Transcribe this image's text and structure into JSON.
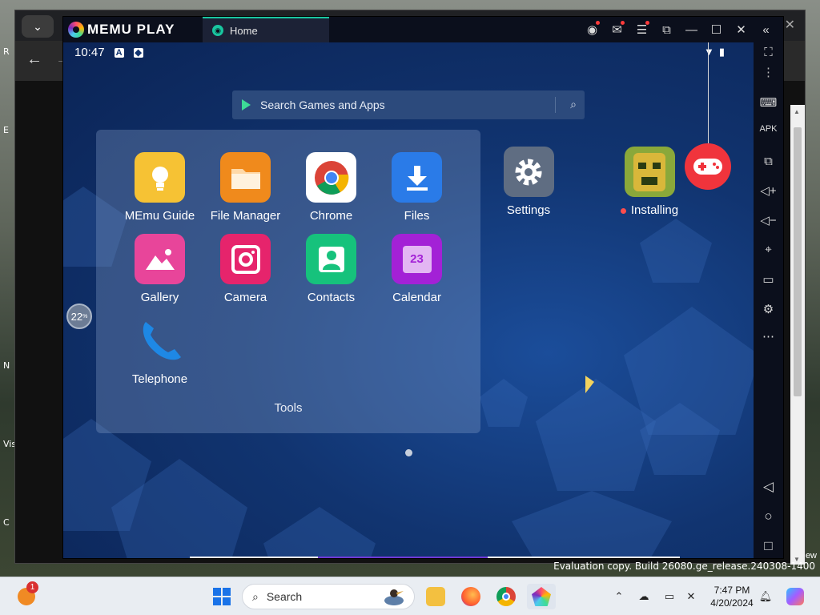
{
  "desktop": {
    "side_labels": [
      "R",
      "E",
      "N",
      "Vis",
      "C"
    ],
    "right_label": "ew"
  },
  "memu": {
    "logo_text": "MEMU PLAY",
    "tab_label": "Home",
    "statusbar": {
      "time": "10:47"
    },
    "search_placeholder": "Search Games and Apps",
    "folder": {
      "name": "Tools",
      "apps": [
        {
          "label": "MEmu Guide",
          "icon": "lightbulb-icon",
          "color": "#f6c234"
        },
        {
          "label": "File Manager",
          "icon": "folder-icon",
          "color": "#f08a1c"
        },
        {
          "label": "Chrome",
          "icon": "chrome-icon",
          "color": "#ffffff"
        },
        {
          "label": "Files",
          "icon": "download-icon",
          "color": "#2a7be8"
        },
        {
          "label": "Gallery",
          "icon": "image-icon",
          "color": "#e8459a"
        },
        {
          "label": "Camera",
          "icon": "camera-icon",
          "color": "#e6246c"
        },
        {
          "label": "Contacts",
          "icon": "person-icon",
          "color": "#16c27c"
        },
        {
          "label": "Calendar",
          "icon": "calendar-icon",
          "color": "#a321d6"
        },
        {
          "label": "Telephone",
          "icon": "phone-icon",
          "color": "#1e88e5"
        }
      ],
      "calendar_day": "23"
    },
    "desktop_apps": [
      {
        "label": "Settings",
        "icon": "gear-icon",
        "color": "#5f6d82"
      },
      {
        "label": "Installing",
        "icon": "temple-run-icon",
        "color": "#8aa83a"
      }
    ],
    "gauge_value": "22",
    "gauge_unit": "%"
  },
  "eval_copy": "Evaluation copy. Build 26080.ge_release.240308-1400",
  "taskbar": {
    "weather_badge": "1",
    "search_label": "Search",
    "clock_time": "7:47 PM",
    "clock_date": "4/20/2024"
  }
}
